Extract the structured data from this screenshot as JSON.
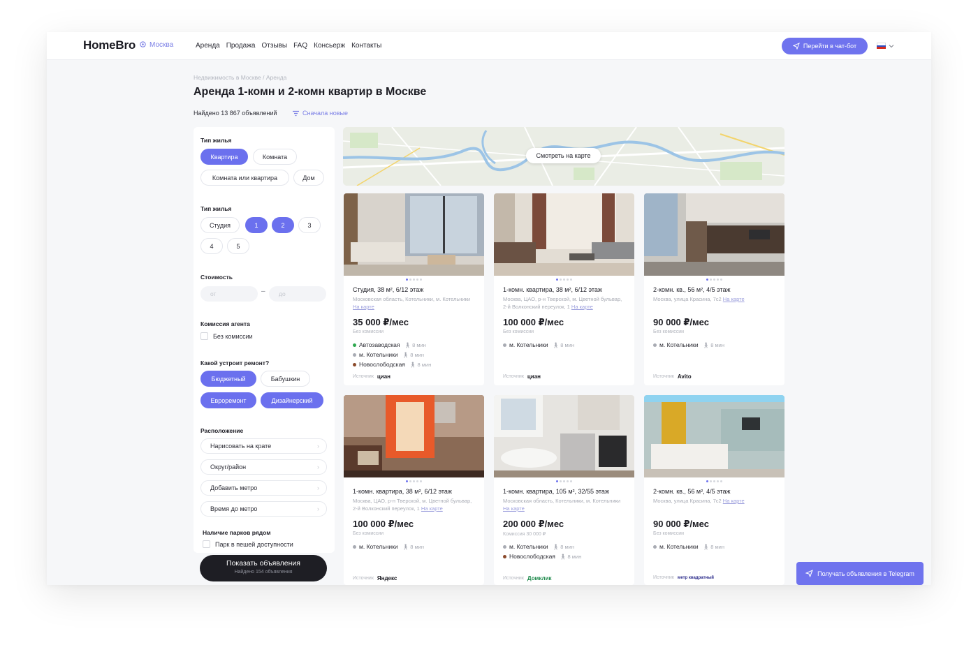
{
  "header": {
    "logo": "HomeBro",
    "city": "Москва",
    "nav": [
      "Аренда",
      "Продажа",
      "Отзывы",
      "FAQ",
      "Консьерж",
      "Контакты"
    ],
    "chatbot_label": "Перейти в чат-бот"
  },
  "page": {
    "breadcrumb": "Недвижимость в Москве / Аренда",
    "title": "Аренда 1-комн и 2-комн квартир в Москве",
    "found": "Найдено 13 867 объявлений",
    "sort": "Сначала новые"
  },
  "filters": {
    "housing_type": {
      "label": "Тип жилья",
      "options": [
        "Квартира",
        "Комната",
        "Комната или квартира",
        "Дом"
      ],
      "selected": "Квартира"
    },
    "rooms": {
      "label": "Тип жилья",
      "options": [
        "Студия",
        "1",
        "2",
        "3",
        "4",
        "5"
      ],
      "selected": [
        "1",
        "2"
      ]
    },
    "price": {
      "label": "Стоимость",
      "from_placeholder": "от",
      "to_placeholder": "до"
    },
    "commission": {
      "label": "Комиссия агента",
      "checkbox": "Без комиссии"
    },
    "renovation": {
      "label": "Какой устроит ремонт?",
      "options": [
        "Бюджетный",
        "Бабушкин",
        "Евроремонт",
        "Дизайнерский"
      ],
      "selected": [
        "Бюджетный",
        "Евроремонт",
        "Дизайнерский"
      ]
    },
    "location": {
      "label": "Расположение",
      "items": [
        "Нарисовать на крате",
        "Округ/район",
        "Добавить метро",
        "Время до метро"
      ]
    },
    "parks": {
      "label": "Наличие парков рядом",
      "checkbox": "Парк в пешей доступности"
    }
  },
  "show_button": {
    "label": "Показать объявления",
    "sub": "Найдено 154 объявления"
  },
  "map": {
    "button": "Смотреть на карте"
  },
  "listings": [
    {
      "title": "Студия, 38 м², 6/12 этаж",
      "address": "Московская область, Котельники, м. Котельники",
      "map_link": "На карте",
      "price": "35 000 ₽/мес",
      "commission": "Без комиссии",
      "metro": [
        {
          "name": "Автозаводская",
          "time": "8 мин",
          "color": "#2fa84f"
        },
        {
          "name": "м. Котельники",
          "time": "8 мин",
          "color": "#a8abb3"
        },
        {
          "name": "Новослободская",
          "time": "8 мин",
          "color": "#8b4a2b"
        }
      ],
      "source_label": "Источник",
      "source": "циан"
    },
    {
      "title": "1-комн. квартира, 38 м², 6/12 этаж",
      "address": "Москва, ЦАО, р-н Тверской, м. Цветной бульвар, 2-й Волконский переулок, 1",
      "map_link": "На карте",
      "price": "100 000 ₽/мес",
      "commission": "Без комиссии",
      "metro": [
        {
          "name": "м. Котельники",
          "time": "8 мин",
          "color": "#a8abb3"
        }
      ],
      "source_label": "Источник",
      "source": "циан"
    },
    {
      "title": "2-комн. кв., 56 м², 4/5 этаж",
      "address": "Москва, улица Красина, 7с2",
      "map_link": "На карте",
      "price": "90 000 ₽/мес",
      "commission": "Без комиссии",
      "metro": [
        {
          "name": "м. Котельники",
          "time": "8 мин",
          "color": "#a8abb3"
        }
      ],
      "source_label": "Источник",
      "source": "Avito"
    },
    {
      "title": "1-комн. квартира, 38 м², 6/12 этаж",
      "address": "Москва, ЦАО, р-н Тверской, м. Цветной бульвар, 2-й Волконский переулок, 1",
      "map_link": "На карте",
      "price": "100 000 ₽/мес",
      "commission": "Без комиссии",
      "metro": [
        {
          "name": "м. Котельники",
          "time": "8 мин",
          "color": "#a8abb3"
        }
      ],
      "source_label": "Источник",
      "source": "Яндекс"
    },
    {
      "title": "1-комн. квартира, 105 м², 32/55 этаж",
      "address": "Московская область, Котельники, м. Котельники",
      "map_link": "На карте",
      "price": "200 000 ₽/мес",
      "commission": "Комиссия 30 000 ₽",
      "metro": [
        {
          "name": "м. Котельники",
          "time": "8 мин",
          "color": "#a8abb3"
        },
        {
          "name": "Новослободская",
          "time": "8 мин",
          "color": "#8b4a2b"
        }
      ],
      "source_label": "Источник",
      "source": "Домклик"
    },
    {
      "title": "2-комн. кв., 56 м², 4/5 этаж",
      "address": "Москва, улица Красина, 7с2",
      "map_link": "На карте",
      "price": "90 000 ₽/мес",
      "commission": "Без комиссии",
      "metro": [
        {
          "name": "м. Котельники",
          "time": "8 мин",
          "color": "#a8abb3"
        }
      ],
      "source_label": "Источник",
      "source": "метр квадратный"
    }
  ],
  "telegram_button": "Получать объявления в Telegram",
  "colors": {
    "accent": "#6f73ee",
    "dark_button": "#1e1e24",
    "background": "#f6f7f9"
  },
  "icons": [
    "location-pin-icon",
    "send-icon",
    "filter-icon",
    "chevron-down-icon",
    "chevron-right-icon",
    "walk-icon",
    "russia-flag-icon"
  ]
}
